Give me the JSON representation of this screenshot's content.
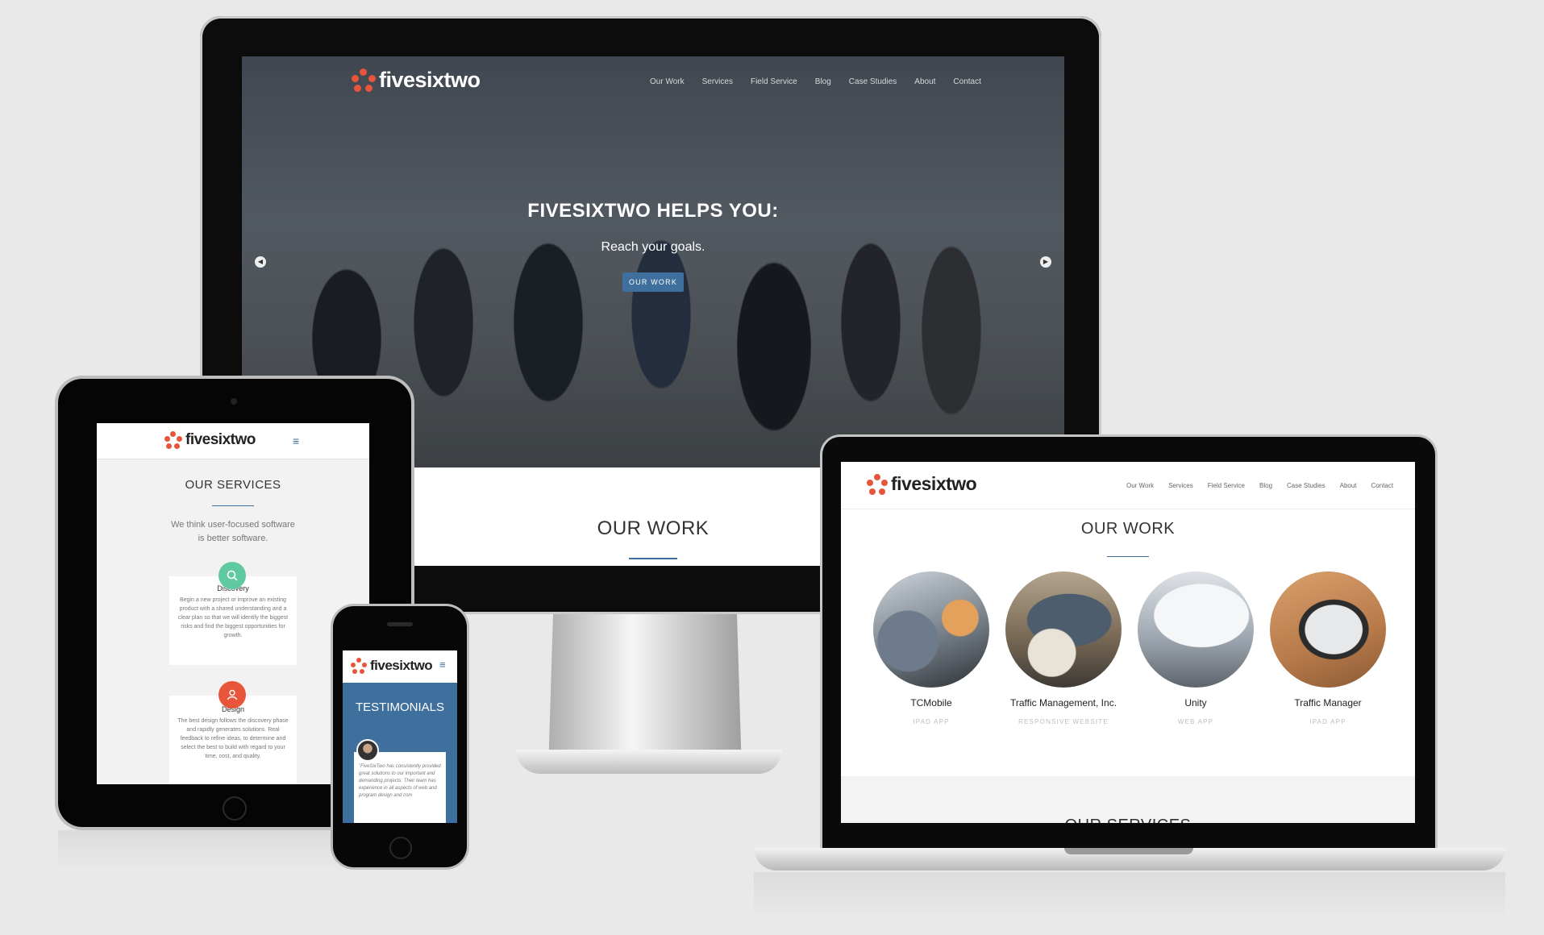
{
  "brand": {
    "name": "fivesixtwo",
    "accent": "#e8553a",
    "primary": "#3f6f9c"
  },
  "desktop": {
    "nav": [
      "Our Work",
      "Services",
      "Field Service",
      "Blog",
      "Case Studies",
      "About",
      "Contact"
    ],
    "hero": {
      "title": "FIVESIXTWO HELPS YOU:",
      "subtitle": "Reach your goals.",
      "button": "OUR WORK"
    },
    "section_title": "OUR WORK"
  },
  "tablet": {
    "section_title": "OUR SERVICES",
    "intro": "We think user-focused software is better software.",
    "services": [
      {
        "title": "Discovery",
        "icon": "search-icon",
        "color": "#5fcaa0",
        "text": "Begin a new project or improve an existing product with a shared understanding and a clear plan so that we will identify the biggest risks and find the biggest opportunities for growth."
      },
      {
        "title": "Design",
        "icon": "user-icon",
        "color": "#e8553a",
        "text": "The best design follows the discovery phase and rapidly generates solutions. Real feedback to refine ideas, to determine and select the best to build with regard to your time, cost, and quality."
      }
    ]
  },
  "phone": {
    "section_title": "TESTIMONIALS",
    "quote": "\"FiveSixTwo has consistently provided great solutions to our important and demanding projects. Their team has experience in all aspects of web and program design and com"
  },
  "laptop": {
    "nav": [
      "Our Work",
      "Services",
      "Field Service",
      "Blog",
      "Case Studies",
      "About",
      "Contact"
    ],
    "section_title": "OUR WORK",
    "next_section": "OUR SERVICES",
    "work": [
      {
        "name": "TCMobile",
        "type": "IPAD APP"
      },
      {
        "name": "Traffic Management, Inc.",
        "type": "RESPONSIVE WEBSITE"
      },
      {
        "name": "Unity",
        "type": "WEB APP"
      },
      {
        "name": "Traffic Manager",
        "type": "IPAD APP"
      }
    ]
  }
}
